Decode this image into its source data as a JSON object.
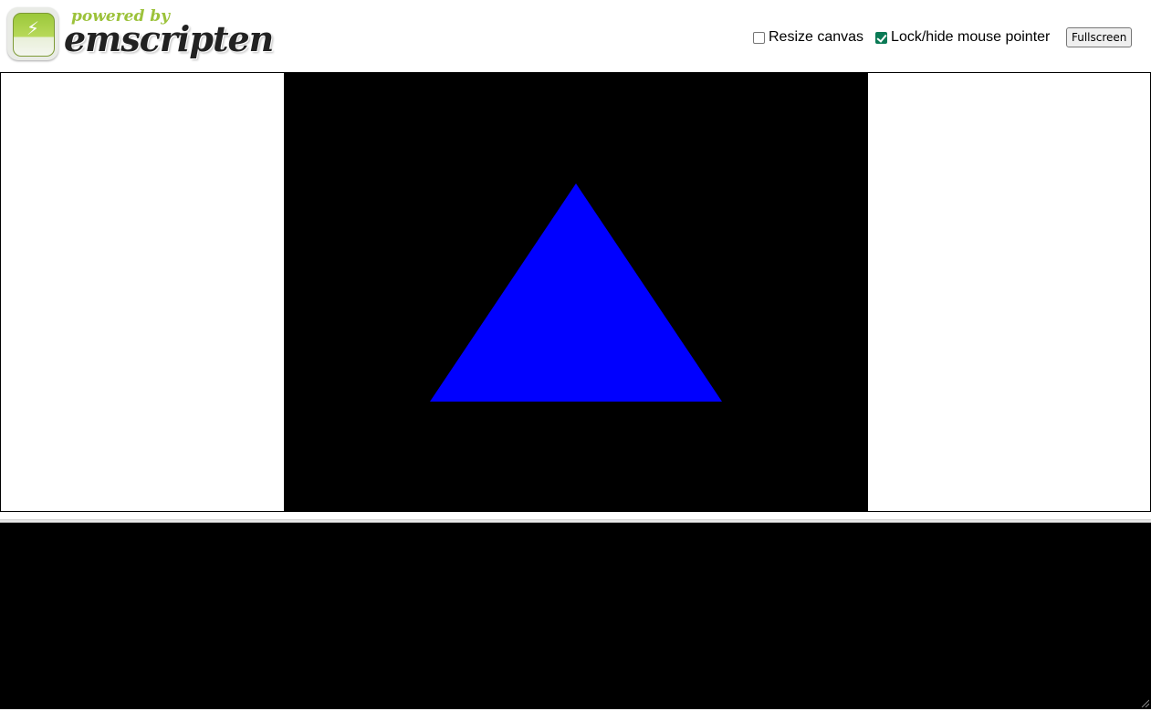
{
  "header": {
    "logo": {
      "powered_text": "powered by",
      "brand_text": "emscripten",
      "icon": "lightning-bolt-icon"
    },
    "controls": {
      "resize_canvas": {
        "label": "Resize canvas",
        "checked": false
      },
      "lock_pointer": {
        "label": "Lock/hide mouse pointer",
        "checked": true
      },
      "fullscreen_label": "Fullscreen"
    }
  },
  "canvas": {
    "background": "#000000",
    "shape": "triangle",
    "shape_color": "#0000ff"
  },
  "output": {
    "background": "#000000",
    "text": ""
  },
  "colors": {
    "checkbox_accent": "#0a7a55",
    "logo_green": "#9cc23a"
  }
}
